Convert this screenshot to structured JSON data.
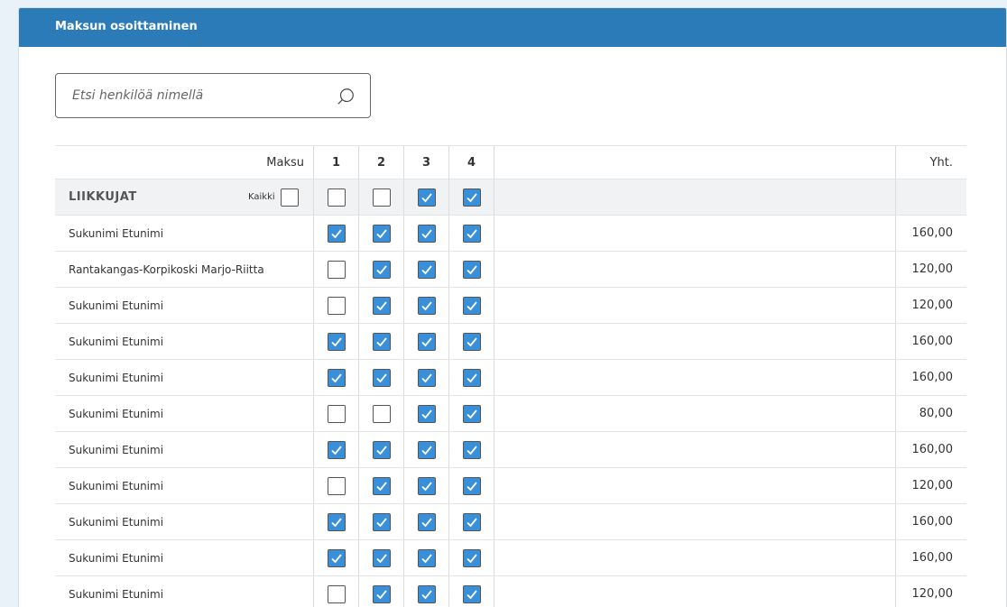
{
  "panel": {
    "title": "Maksun osoittaminen"
  },
  "search": {
    "placeholder": "Etsi henkilöä nimellä",
    "icon": "search-icon"
  },
  "table": {
    "header": {
      "payment_label": "Maksu",
      "payments": [
        "1",
        "2",
        "3",
        "4"
      ],
      "total_label": "Yht."
    },
    "group": {
      "name": "LIIKKUJAT",
      "all_label": "Kaikki",
      "all_checked": false,
      "payment_checked": [
        false,
        false,
        true,
        true
      ]
    },
    "rows": [
      {
        "name": "Sukunimi Etunimi",
        "checks": [
          true,
          true,
          true,
          true
        ],
        "total": "160,00"
      },
      {
        "name": "Rantakangas-Korpikoski Marjo-Riitta",
        "checks": [
          false,
          true,
          true,
          true
        ],
        "total": "120,00"
      },
      {
        "name": "Sukunimi Etunimi",
        "checks": [
          false,
          true,
          true,
          true
        ],
        "total": "120,00"
      },
      {
        "name": "Sukunimi Etunimi",
        "checks": [
          true,
          true,
          true,
          true
        ],
        "total": "160,00"
      },
      {
        "name": "Sukunimi Etunimi",
        "checks": [
          true,
          true,
          true,
          true
        ],
        "total": "160,00"
      },
      {
        "name": "Sukunimi Etunimi",
        "checks": [
          false,
          false,
          true,
          true
        ],
        "total": "80,00"
      },
      {
        "name": "Sukunimi Etunimi",
        "checks": [
          true,
          true,
          true,
          true
        ],
        "total": "160,00"
      },
      {
        "name": "Sukunimi Etunimi",
        "checks": [
          false,
          true,
          true,
          true
        ],
        "total": "120,00"
      },
      {
        "name": "Sukunimi Etunimi",
        "checks": [
          true,
          true,
          true,
          true
        ],
        "total": "160,00"
      },
      {
        "name": "Sukunimi Etunimi",
        "checks": [
          true,
          true,
          true,
          true
        ],
        "total": "160,00"
      },
      {
        "name": "Sukunimi Etunimi",
        "checks": [
          false,
          true,
          true,
          true
        ],
        "total": "120,00"
      }
    ]
  },
  "colors": {
    "header": "#2b7bb9",
    "checkbox": "#3a8fd9",
    "background": "#e9f1f9",
    "group_row": "#f1f2f3"
  }
}
